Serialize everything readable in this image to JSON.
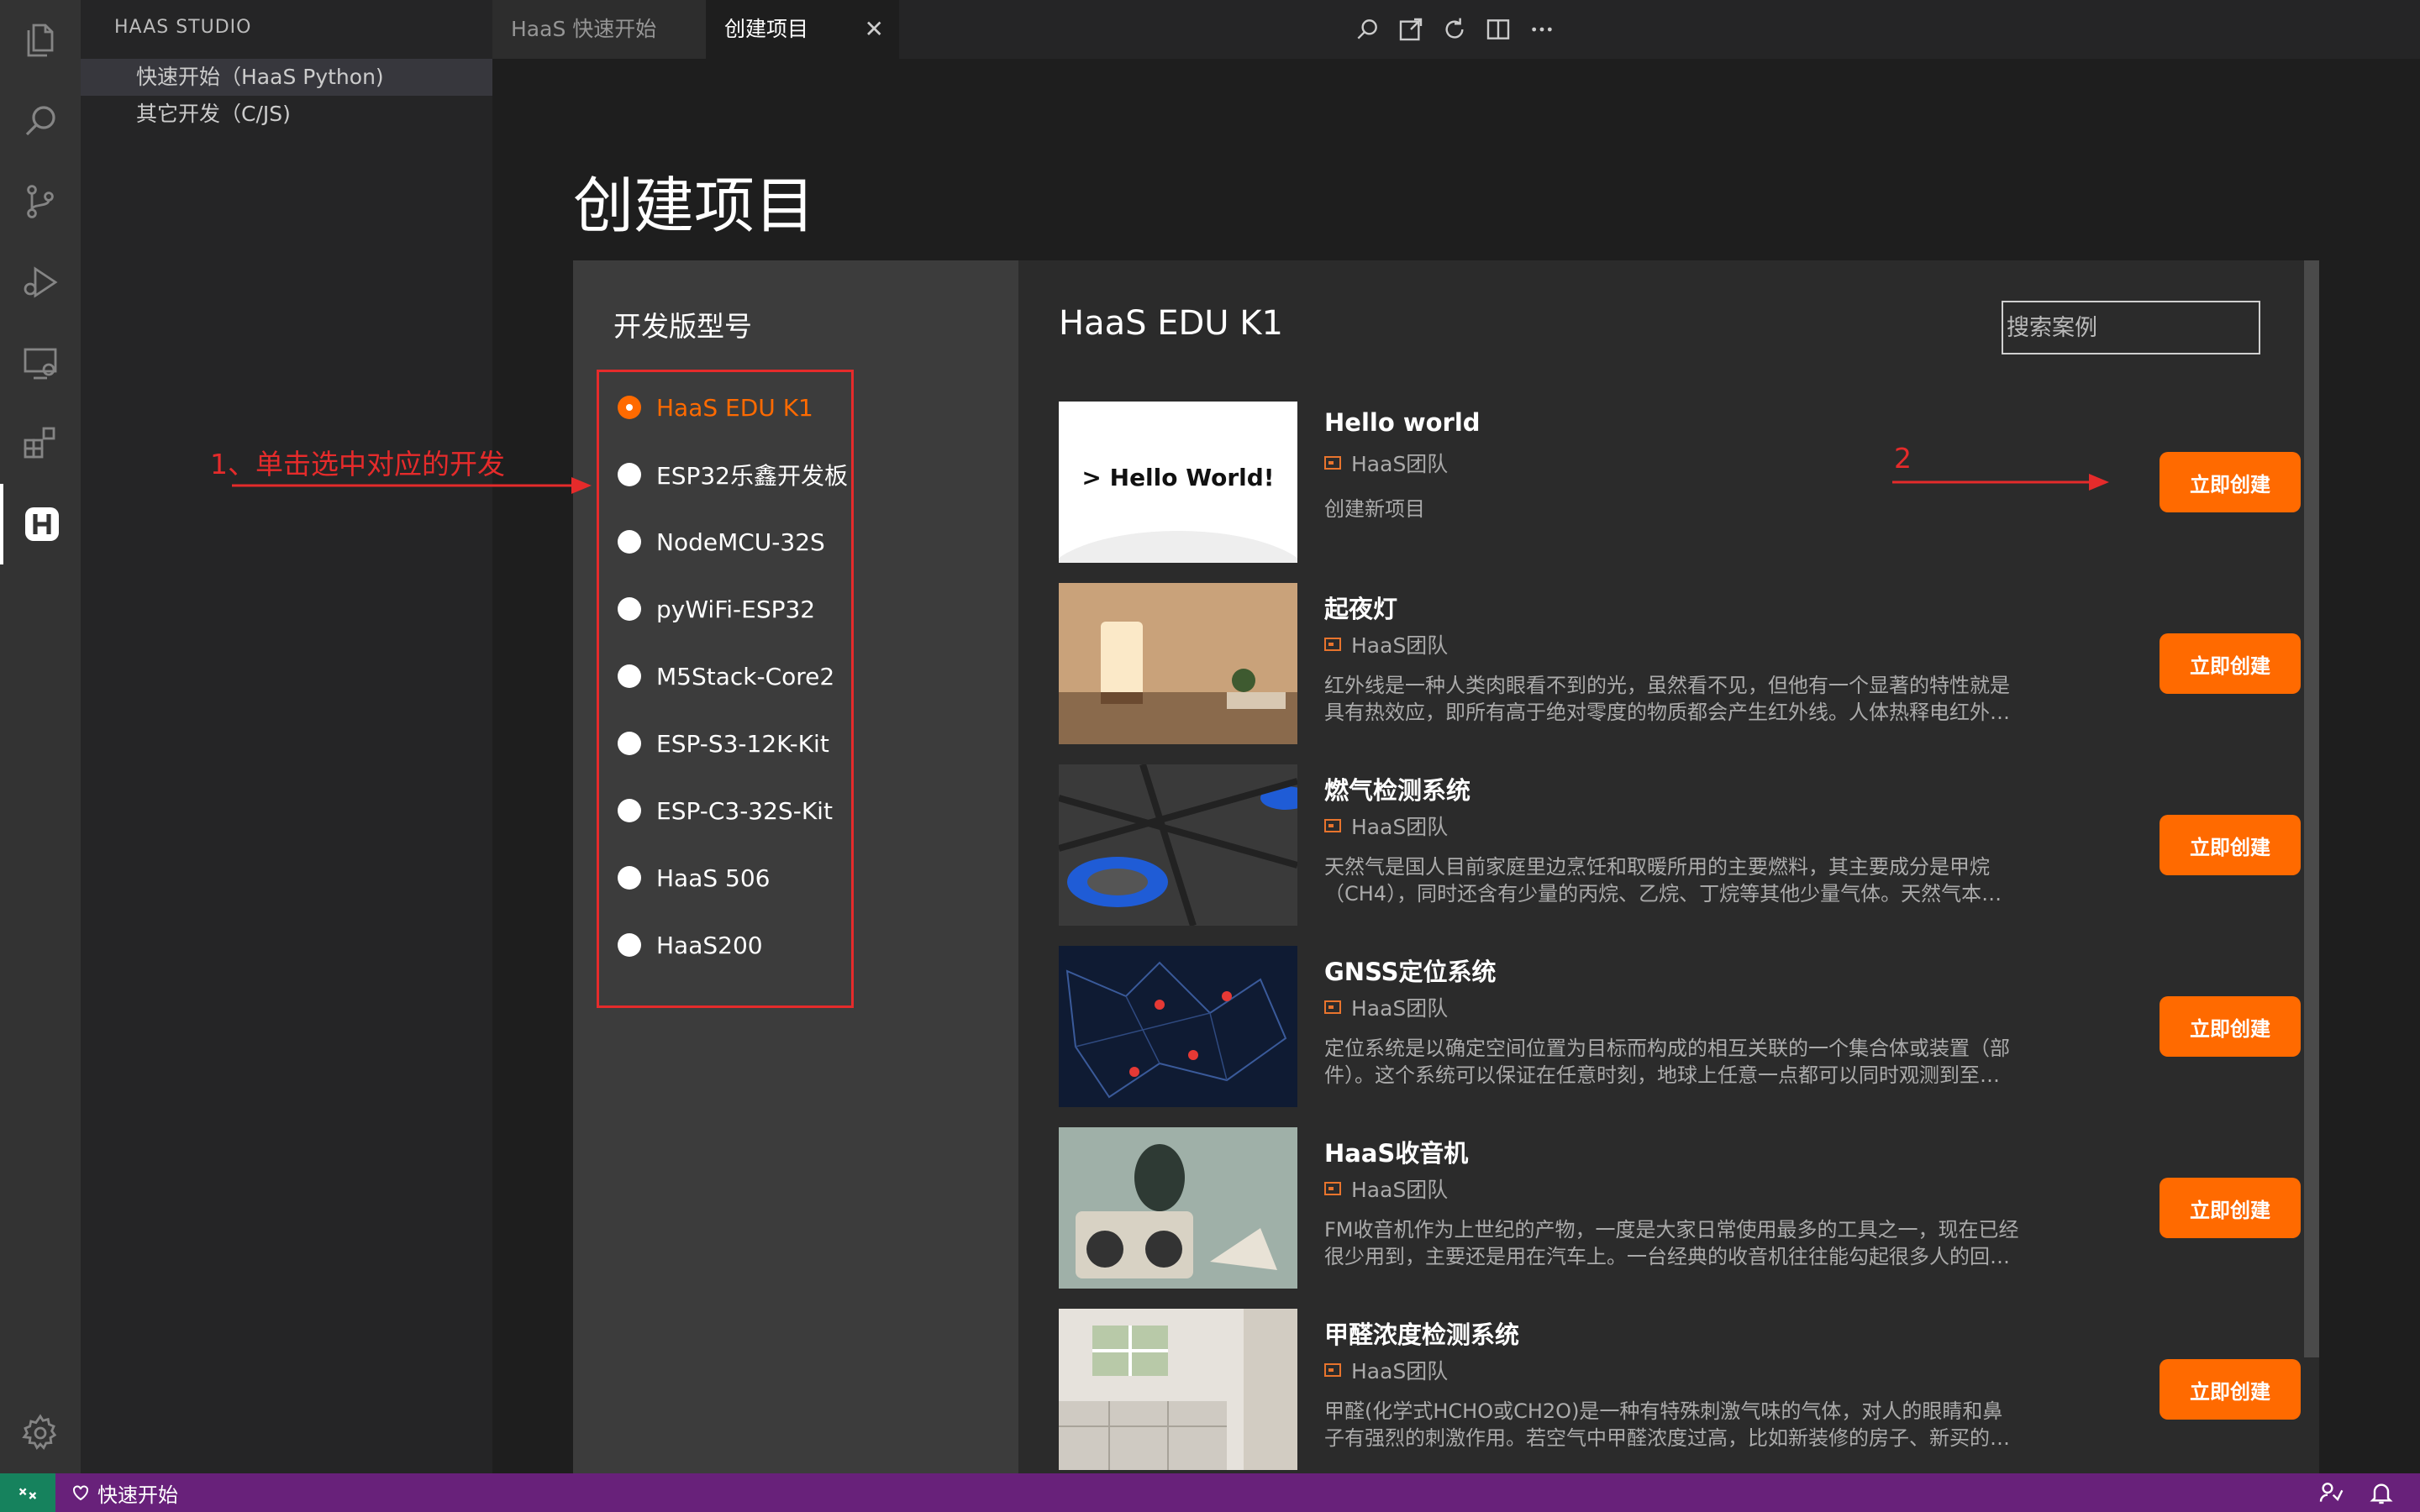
{
  "sidebar": {
    "title": "HAAS STUDIO",
    "items": [
      {
        "label": "快速开始（HaaS Python)"
      },
      {
        "label": "其它开发（C/JS)"
      }
    ]
  },
  "tabs": [
    {
      "label": "HaaS 快速开始"
    },
    {
      "label": "创建项目"
    }
  ],
  "tab_close_glyph": "✕",
  "page": {
    "title": "创建项目"
  },
  "boards": {
    "heading": "开发版型号",
    "options": [
      {
        "label": "HaaS EDU K1",
        "checked": true
      },
      {
        "label": "ESP32乐鑫开发板",
        "checked": false
      },
      {
        "label": "NodeMCU-32S",
        "checked": false
      },
      {
        "label": "pyWiFi-ESP32",
        "checked": false
      },
      {
        "label": "M5Stack-Core2",
        "checked": false
      },
      {
        "label": "ESP-S3-12K-Kit",
        "checked": false
      },
      {
        "label": "ESP-C3-32S-Kit",
        "checked": false
      },
      {
        "label": "HaaS 506",
        "checked": false
      },
      {
        "label": "HaaS200",
        "checked": false
      }
    ]
  },
  "cases": {
    "heading": "HaaS EDU K1",
    "search_placeholder": "搜索案例",
    "create_label": "立即创建",
    "items": [
      {
        "title": "Hello world",
        "author": "HaaS团队",
        "desc": "创建新项目",
        "thumb_text": "> Hello World!"
      },
      {
        "title": "起夜灯",
        "author": "HaaS团队",
        "desc": "红外线是一种人类肉眼看不到的光，虽然看不见，但他有一个显著的特性就是具有热效应，即所有高于绝对零度的物质都会产生红外线。人体热释电红外…"
      },
      {
        "title": "燃气检测系统",
        "author": "HaaS团队",
        "desc": "天然气是国人目前家庭里边烹饪和取暖所用的主要燃料，其主要成分是甲烷（CH4），同时还含有少量的丙烷、乙烷、丁烷等其他少量气体。天然气本…"
      },
      {
        "title": "GNSS定位系统",
        "author": "HaaS团队",
        "desc": "定位系统是以确定空间位置为目标而构成的相互关联的一个集合体或装置（部件）。这个系统可以保证在任意时刻，地球上任意一点都可以同时观测到至…"
      },
      {
        "title": "HaaS收音机",
        "author": "HaaS团队",
        "desc": "FM收音机作为上世纪的产物，一度是大家日常使用最多的工具之一，现在已经很少用到，主要还是用在汽车上。一台经典的收音机往往能勾起很多人的回…"
      },
      {
        "title": "甲醛浓度检测系统",
        "author": "HaaS团队",
        "desc": "甲醛(化学式HCHO或CH2O)是一种有特殊刺激气味的气体，对人的眼睛和鼻子有强烈的刺激作用。若空气中甲醛浓度过高，比如新装修的房子、新买的汽…"
      }
    ]
  },
  "annotations": {
    "step1": "1、单击选中对应的开发",
    "step2": "2"
  },
  "statusbar": {
    "quick_start": "快速开始"
  },
  "colors": {
    "accent": "#ff6a00",
    "annotation": "#e52b2b",
    "statusbar": "#68217a",
    "remote": "#16825d"
  }
}
